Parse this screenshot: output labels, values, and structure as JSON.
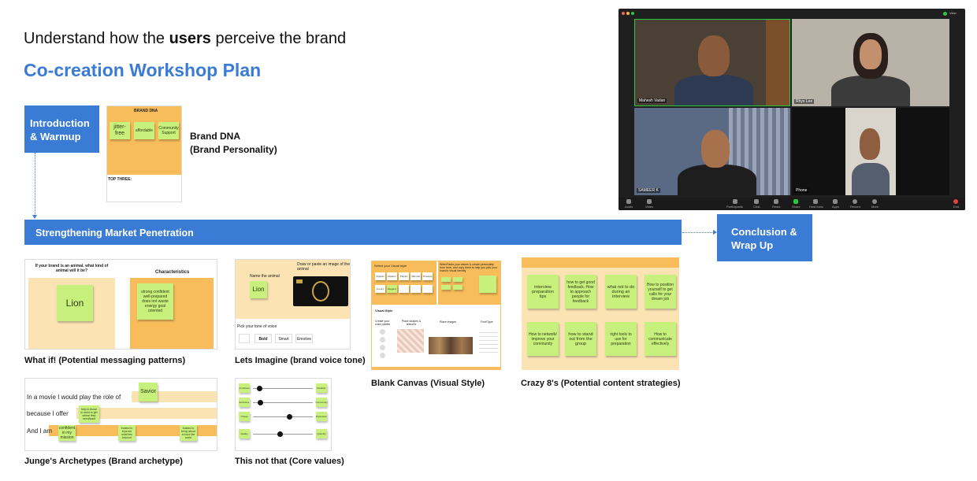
{
  "header": {
    "line_pre": "Understand how the ",
    "line_bold": "users",
    "line_post": " perceive the brand",
    "subtitle": "Co-creation Workshop Plan"
  },
  "flow": {
    "intro": "Introduction & Warmup",
    "strip": "Strengthening Market Penetration",
    "conclusion": "Conclusion & Wrap Up"
  },
  "brand_dna": {
    "board_title": "BRAND DNA",
    "stickies": [
      "jitter-free",
      "affordable",
      "Community Support"
    ],
    "top_three": "TOP THREE:",
    "caption_line1": "Brand DNA",
    "caption_line2": "(Brand Personality)"
  },
  "what_if": {
    "question": "If your brand is an animal, what kind of animal will it be?",
    "characteristics": "Characteristics",
    "sticky_animal": "Lion",
    "sticky_traits": "strong confident well-prepared does not waste energy goal oriented",
    "caption": "What if! (Potential messaging patterns)"
  },
  "lets_imagine": {
    "name_label": "Name the animal",
    "image_label": "Draw or paste an image of the animal",
    "sticky": "Lion",
    "tone_label": "Pick your tone of voice",
    "tones": [
      "",
      "Bold",
      "Smart",
      "Emotive"
    ],
    "caption": "Lets Imagine (brand voice tone)"
  },
  "blank_canvas": {
    "left_title": "Select your Visual style",
    "right_title": "Write/Paste your values & create personality from here, and copy them to help you pick your brand's visual identity",
    "chips": [
      "Organic",
      "Modern",
      "Playful",
      "Minimal",
      "Timeless",
      "Luxury",
      "Elegant",
      "",
      "",
      ""
    ],
    "visual_style": "Visual Style",
    "col_palette": "Create your color palette",
    "col_shapes": "Place shapes & textures",
    "col_images": "Place images",
    "col_font": "Font/Type",
    "caption": "Blank Canvas (Visual Style)"
  },
  "crazy8": {
    "stickies": [
      "interview preparation tips",
      "how to get good feedback. How to approach people for feedback",
      "what not to do during an interview",
      "How to position yourself to get calls for your dream job",
      "How to network/ improve your community",
      "how to stand out from the group",
      "right tools to use for preparation",
      "How to communicate effectively"
    ],
    "caption": "Crazy 8's (Potential content strategies)"
  },
  "archetypes": {
    "row1": "In a movie I would play the role of",
    "row2": "because I offer",
    "row3": "And I am",
    "sticky_role": "Savior",
    "sticky_offer": "help to those in need to get where they need/want",
    "sticky_am1": "confident in my mission",
    "sticky_am2": "trusted to improve what lies beyond",
    "sticky_am3": "trusted to bring about a more fair world",
    "caption": "Junge's Archetypes (Brand archetype)"
  },
  "this_not_that": {
    "left": [
      "Ambitious",
      "Exclusive",
      "Cheap",
      "Quality"
    ],
    "right": [
      "Realistic",
      "Community",
      "Expensive",
      "Quantity"
    ],
    "positions": [
      0.1,
      0.12,
      0.6,
      0.45
    ],
    "caption": "This not that (Core values)"
  },
  "zoom": {
    "participants": [
      "Mahesh Vadan",
      "Rhys Lee",
      "SAMEER K",
      "Phone"
    ],
    "controls": [
      "Audio",
      "Video",
      "Participants",
      "Chat",
      "React",
      "Share",
      "Host tools",
      "Apps",
      "Record",
      "More",
      "End"
    ],
    "view_label": "View",
    "colors": {
      "bg": "#1f1f1f",
      "active": "#27c93f",
      "end": "#e0413a"
    }
  },
  "colors": {
    "accent": "#3a7bd5",
    "sticky": "#c8f07c",
    "board": "#f8bc5a",
    "board_light": "#fbe3b4"
  }
}
